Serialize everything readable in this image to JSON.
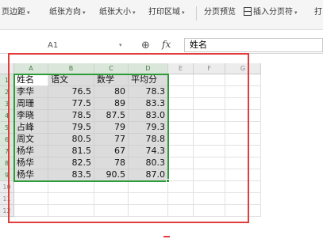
{
  "ribbon": {
    "page_margin": "页边距",
    "orientation": "纸张方向",
    "paper_size": "纸张大小",
    "print_area": "打印区域",
    "page_break_preview": "分页预览",
    "insert_page_break": "插入分页符",
    "print_titles": "打"
  },
  "formula_bar": {
    "name_box": "A1",
    "fx": "fx",
    "value": "姓名"
  },
  "columns": [
    "A",
    "B",
    "C",
    "D",
    "E",
    "F",
    "G"
  ],
  "rows": [
    "1",
    "2",
    "3",
    "4",
    "5",
    "6",
    "7",
    "8",
    "9",
    "10",
    "11",
    "12"
  ],
  "table": {
    "headers": [
      "姓名",
      "语文",
      "数学",
      "平均分"
    ],
    "records": [
      [
        "李华",
        "76.5",
        "80",
        "78.3"
      ],
      [
        "周珊",
        "77.5",
        "89",
        "83.3"
      ],
      [
        "李晓",
        "78.5",
        "87.5",
        "83.0"
      ],
      [
        "占峰",
        "79.5",
        "79",
        "79.3"
      ],
      [
        "周文",
        "80.5",
        "77",
        "78.8"
      ],
      [
        "杨华",
        "81.5",
        "67",
        "74.3"
      ],
      [
        "杨华",
        "82.5",
        "78",
        "80.3"
      ],
      [
        "杨华",
        "83.5",
        "90.5",
        "87.0"
      ]
    ]
  },
  "colors": {
    "selection": "#2e9a3a",
    "annotation": "#e23b3b",
    "cell_fill": "#dcdcdc"
  }
}
